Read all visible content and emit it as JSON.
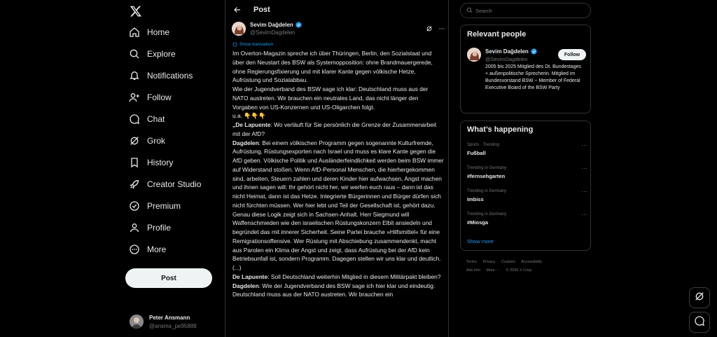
{
  "nav": {
    "items": [
      {
        "label": "Home",
        "icon": "home-icon"
      },
      {
        "label": "Explore",
        "icon": "search-icon"
      },
      {
        "label": "Notifications",
        "icon": "bell-icon"
      },
      {
        "label": "Follow",
        "icon": "person-add-icon"
      },
      {
        "label": "Chat",
        "icon": "chat-icon"
      },
      {
        "label": "Grok",
        "icon": "grok-icon"
      },
      {
        "label": "History",
        "icon": "bookmark-icon"
      },
      {
        "label": "Creator Studio",
        "icon": "rocket-icon"
      },
      {
        "label": "Premium",
        "icon": "verified-icon"
      },
      {
        "label": "Profile",
        "icon": "profile-icon"
      },
      {
        "label": "More",
        "icon": "more-circle-icon"
      }
    ],
    "post_label": "Post"
  },
  "account": {
    "name": "Peter Ansmann",
    "handle": "@ansma_pe95888"
  },
  "center": {
    "title": "Post",
    "author_name": "Sevim Dağdelen",
    "author_handle": "@SevimDagdelen",
    "show_translation": "Show translation",
    "paragraphs": [
      {
        "segments": [
          {
            "text": "Im Overton-Magazin spreche ich über Thüringen, Berlin, den Sozialstaat und über den Neustart des BSW als Systemopposition: ohne Brandmauergerede, ohne Regierungsfixierung und mit klarer Kante gegen völkische Hetze, Aufrüstung und Sozialabbau."
          }
        ]
      },
      {
        "segments": [
          {
            "text": "Wie der Jugendverband des BSW sage ich klar: Deutschland muss aus der NATO austreten. Wir brauchen ein neutrales Land, das nicht länger den Vorgaben von US-Konzernen und US-Oligarchen folgt."
          }
        ]
      },
      {
        "segments": [
          {
            "text": "u.a. 👇👇👇"
          }
        ]
      },
      {
        "segments": [
          {
            "text": "„De Lapuente",
            "bold": true
          },
          {
            "text": ": Wo verläuft für Sie persönlich die Grenze der Zusammenarbeit mit der AfD?"
          }
        ]
      },
      {
        "segments": [
          {
            "text": "Dagdelen",
            "bold": true
          },
          {
            "text": ": Bei einem völkischen Programm gegen sogenannte Kulturfremde, Aufrüstung, Rüstungsexporten nach Israel und muss es klare Kante gegen die AfD geben. Völkische Politik und Ausländerfeindlichkeit werden beim BSW immer auf Widerstand stoßen. Wenn AfD-Personal Menschen, die hierhergekommen sind, arbeiten, Steuern zahlen und deren Kinder hier aufwachsen, Angst machen und ihnen sagen will: Ihr gehört nicht her, wir werfen euch raus – dann ist das nicht Heimat, dann ist das Hetze. Integrierte Bürgerinnen und Bürger dürfen sich nicht fürchten müssen. Wer hier lebt und Teil der Gesellschaft ist, gehört dazu. Genau diese Logik zeigt sich in Sachsen-Anhalt. Herr Siegmund will Waffenschmieden wie den israelischen Rüstungskonzern Elbit ansiedeln und begründet das mit innerer Sicherheit. Seine Partei brauche »Hilfsmittel« für eine Remigrationsoffensive. Wer Rüstung mit Abschiebung zusammendenkt, macht aus Parolen ein Klima der Angst und zeigt, dass Aufrüstung bei der AfD kein Betriebsunfall ist, sondern Programm. Dagegen stellen wir uns klar und deutlich."
          }
        ]
      },
      {
        "segments": [
          {
            "text": "(...)"
          }
        ]
      },
      {
        "segments": [
          {
            "text": "De Lapuente",
            "bold": true
          },
          {
            "text": ": Soll Deutschland weiterhin Mitglied in diesem Militärpakt bleiben?"
          }
        ]
      },
      {
        "segments": [
          {
            "text": "Dagdelen",
            "bold": true
          },
          {
            "text": ": Wie der Jugendverband des BSW sage ich hier klar und eindeutig: Deutschland muss aus der NATO austreten. Wir brauchen ein"
          }
        ]
      }
    ]
  },
  "search": {
    "placeholder": "Search"
  },
  "relevant": {
    "title": "Relevant people",
    "name": "Sevim Dağdelen",
    "handle": "@SevimDagdelen",
    "follow_label": "Follow",
    "bio": "2005 bis 2025 Mitglied des Dt. Bundestages + außenpolitische Sprecherin. Mitglied im Bundesvorstand BSW ~ Member of Federal Executive Board of the BSW Party"
  },
  "happening": {
    "title": "What’s happening",
    "trends": [
      {
        "context": "Sports · Trending",
        "topic": "Fußball"
      },
      {
        "context": "Trending in Germany",
        "topic": "#fernsehgarten"
      },
      {
        "context": "Trending in Germany",
        "topic": "Imbiss"
      },
      {
        "context": "Trending in Germany",
        "topic": "#Miosga"
      }
    ],
    "show_more": "Show more"
  },
  "footer": {
    "row1": [
      "Terms",
      "Privacy",
      "Cookies",
      "Accessibility"
    ],
    "row2": [
      "Ads info",
      "More ···",
      "© 2026 X Corp."
    ]
  },
  "colors": {
    "accent": "#1d9bf0",
    "background": "#000000",
    "border": "#2f3336",
    "muted": "#71767b"
  }
}
